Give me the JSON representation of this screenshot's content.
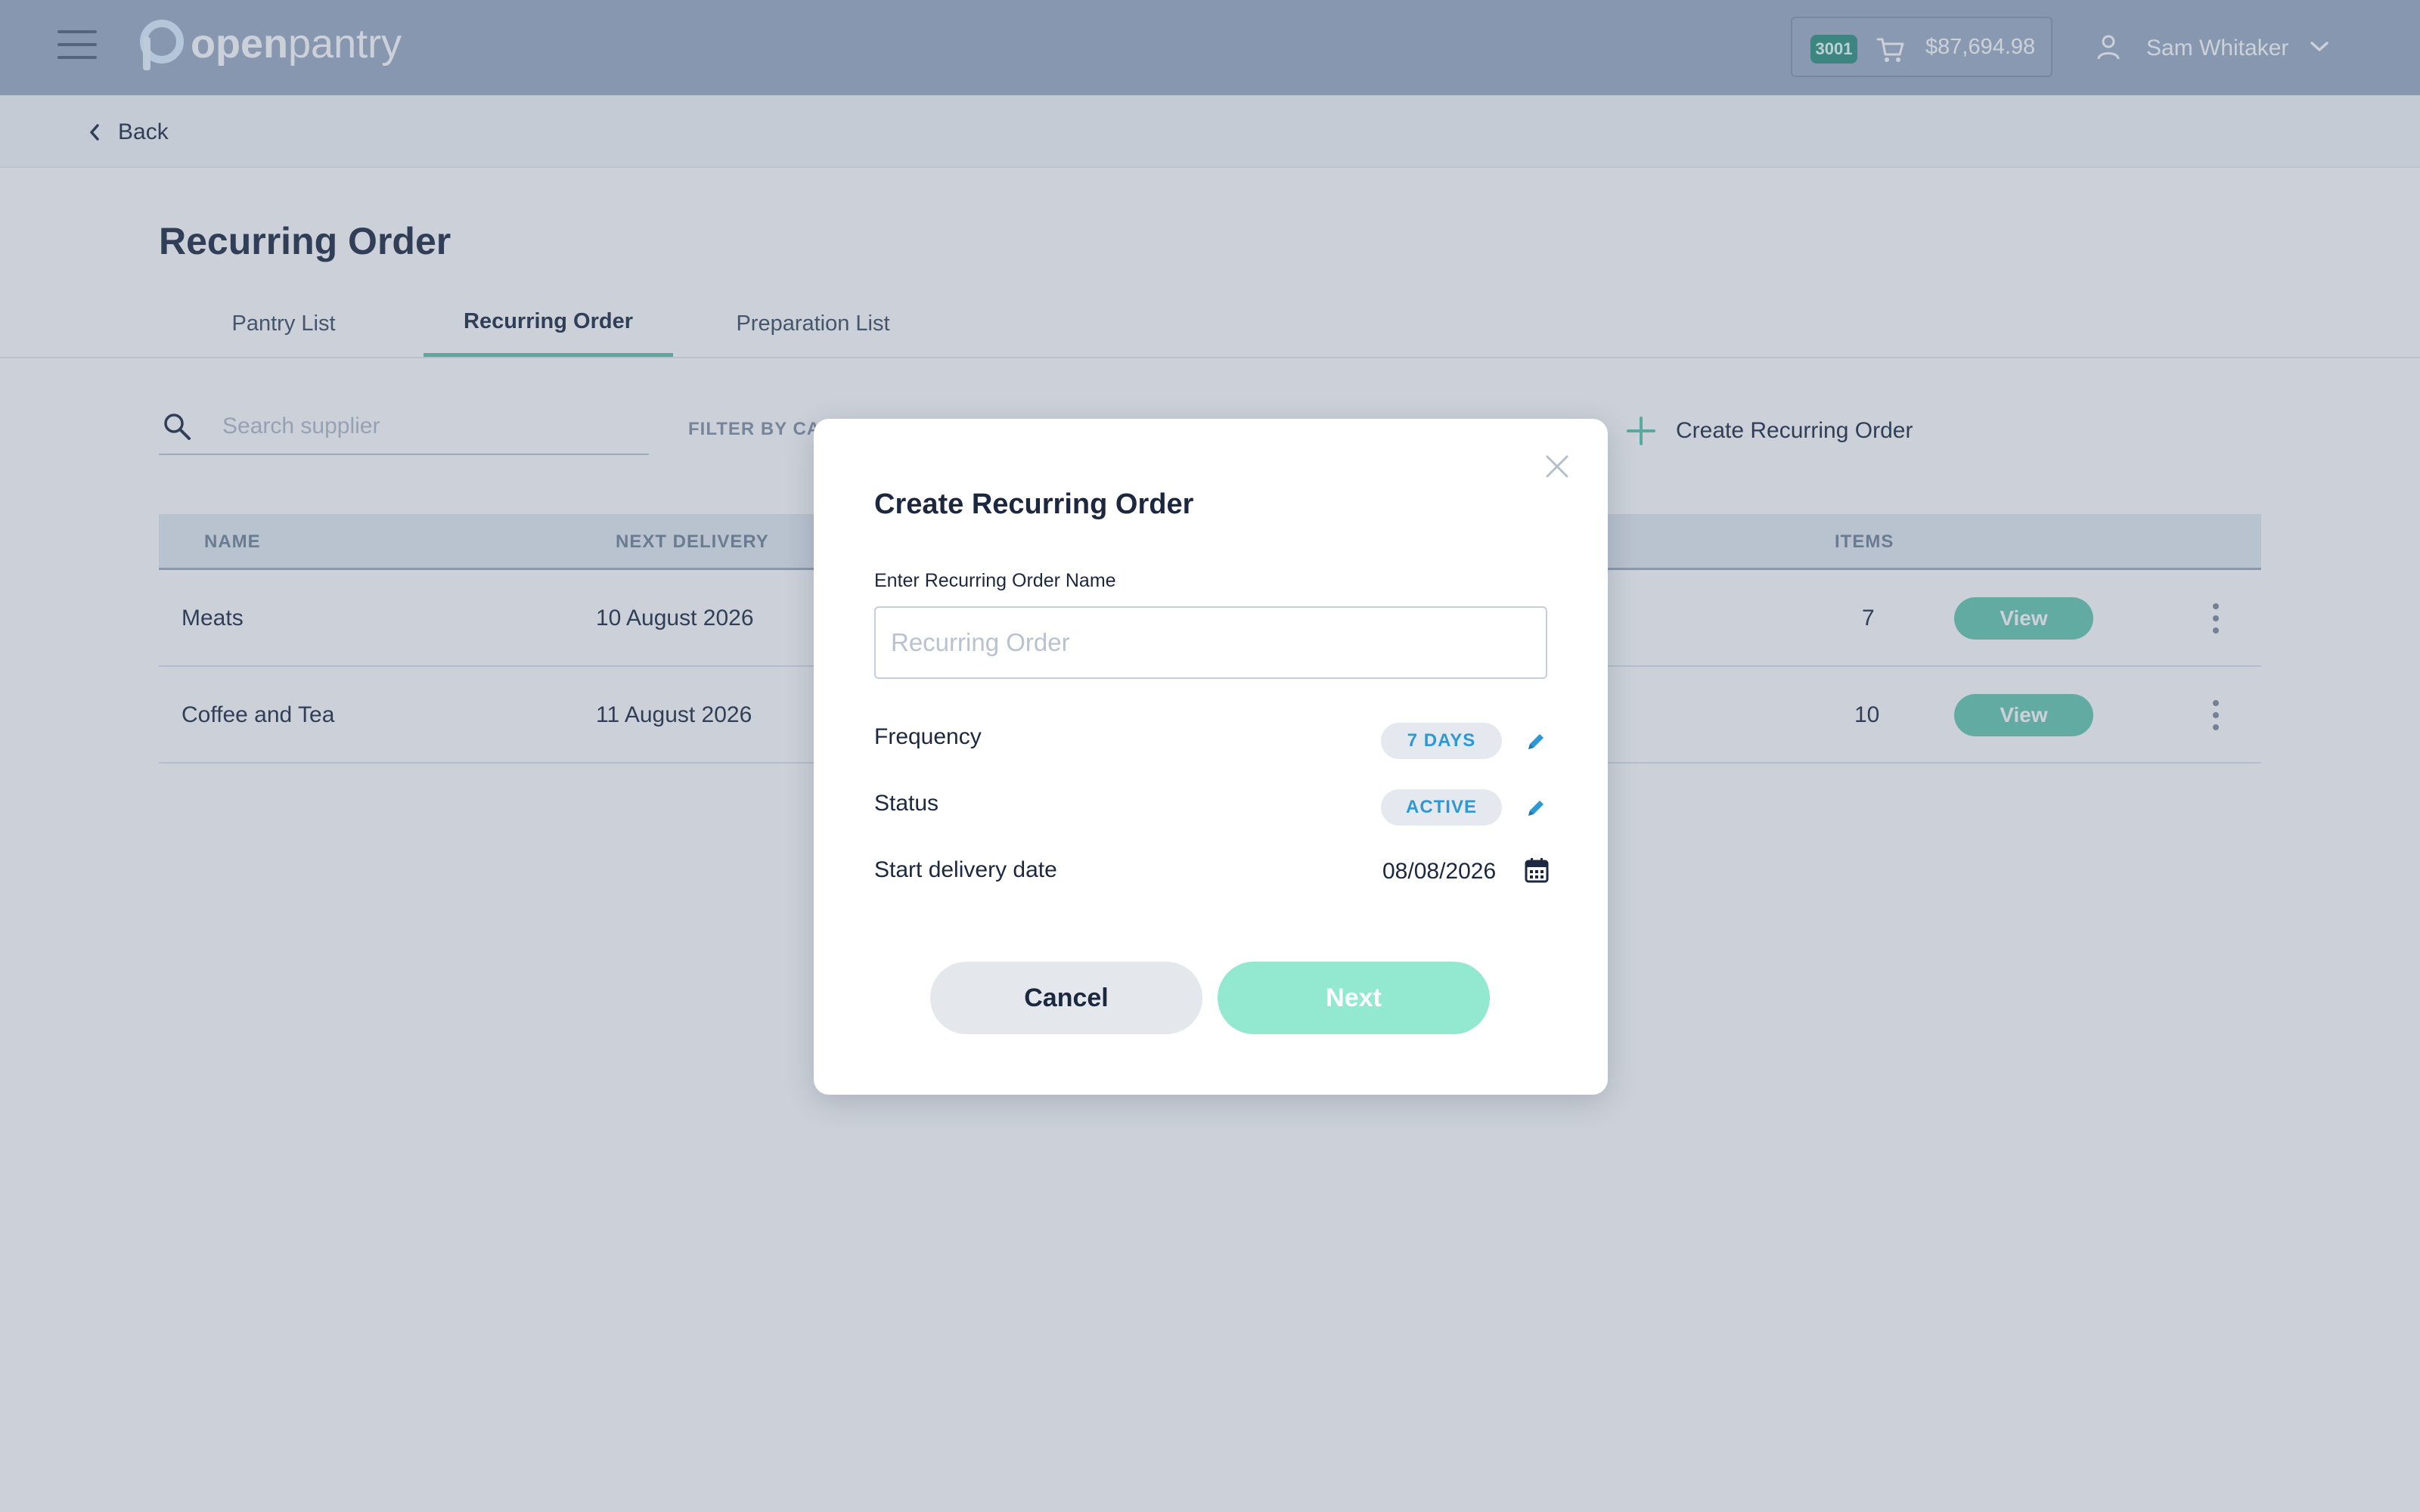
{
  "brand": {
    "logo_bold": "open",
    "logo_light": "pantry",
    "logo_icon": "p-logo-icon"
  },
  "header": {
    "menu_icon": "hamburger-menu-icon",
    "cart_badge": "3001",
    "cart_icon": "cart-icon",
    "cart_total": "$87,694.98",
    "user_icon": "user-icon",
    "user_name": "Sam Whitaker",
    "user_chevron": "chevron-down-icon"
  },
  "back": {
    "label": "Back",
    "icon": "chevron-left-icon"
  },
  "page": {
    "title": "Recurring Order"
  },
  "tabs": [
    {
      "label": "Pantry List",
      "active": false
    },
    {
      "label": "Recurring Order",
      "active": true
    },
    {
      "label": "Preparation List",
      "active": false
    }
  ],
  "toolbar": {
    "search_placeholder": "Search supplier",
    "filter_label": "FILTER BY CAT",
    "create_label": "Create Recurring Order"
  },
  "table": {
    "columns": {
      "name": "NAME",
      "next_delivery": "NEXT DELIVERY",
      "items": "ITEMS"
    },
    "rows": [
      {
        "name": "Meats",
        "next_delivery": "10 August 2026",
        "items": "7",
        "action": "View"
      },
      {
        "name": "Coffee and Tea",
        "next_delivery": "11 August 2026",
        "items": "10",
        "action": "View"
      }
    ]
  },
  "modal": {
    "title": "Create Recurring Order",
    "name_label": "Enter Recurring Order Name",
    "name_placeholder": "Recurring Order",
    "name_value": "",
    "frequency_label": "Frequency",
    "frequency_value": "7 DAYS",
    "status_label": "Status",
    "status_value": "ACTIVE",
    "start_label": "Start delivery date",
    "start_value": "08/08/2026",
    "cancel_label": "Cancel",
    "next_label": "Next"
  },
  "colors": {
    "topbar": "#a3b2c8",
    "accent_teal": "#71cdb6",
    "next_button": "#93e9cf",
    "pill_text_blue": "#2c98d4",
    "text_dark": "#1c2840"
  }
}
